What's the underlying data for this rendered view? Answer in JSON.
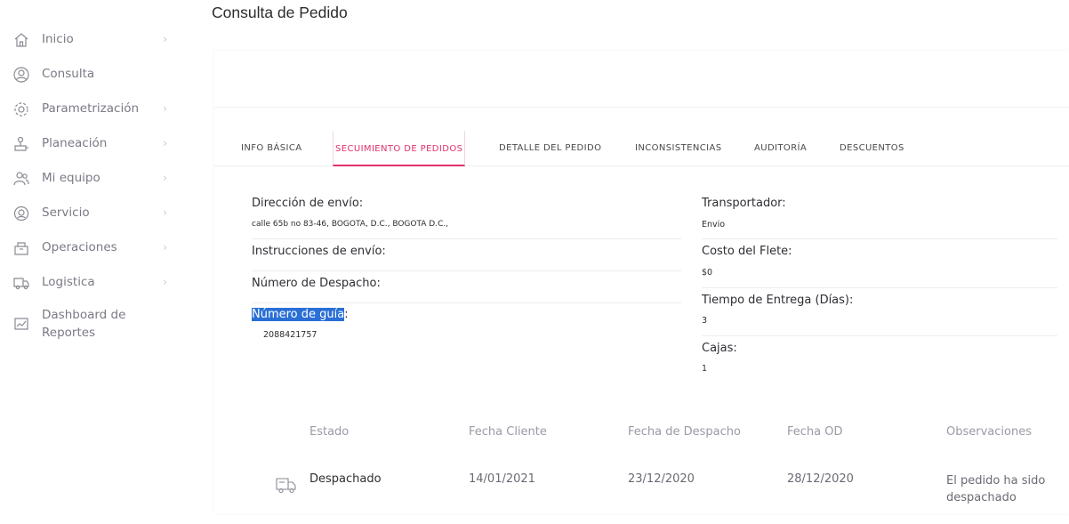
{
  "sidebar": {
    "items": [
      {
        "label": "Inicio",
        "icon": "home-icon",
        "chevron": "›"
      },
      {
        "label": "Consulta",
        "icon": "user-circle-icon",
        "chevron": ""
      },
      {
        "label": "Parametrización",
        "icon": "gear-icon",
        "chevron": "›"
      },
      {
        "label": "Planeación",
        "icon": "planning-icon",
        "chevron": "›"
      },
      {
        "label": "Mi equipo",
        "icon": "team-icon",
        "chevron": "›"
      },
      {
        "label": "Servicio",
        "icon": "support-icon",
        "chevron": "›"
      },
      {
        "label": "Operaciones",
        "icon": "operations-icon",
        "chevron": "›"
      },
      {
        "label": "Logistica",
        "icon": "truck-icon",
        "chevron": "›"
      },
      {
        "label_line1": "Dashboard de",
        "label_line2": "Reportes",
        "icon": "chart-icon",
        "chevron": ""
      }
    ]
  },
  "header": {
    "title": "Consulta de Pedido"
  },
  "tabs": [
    {
      "label": "INFO BÁSICA"
    },
    {
      "label": "SECUIMIENTO DE PEDIDOS",
      "active": true
    },
    {
      "label": "DETALLE DEL PEDIDO"
    },
    {
      "label": "INCONSISTENCIAS"
    },
    {
      "label": "AUDITORÍA"
    },
    {
      "label": "DESCUENTOS"
    }
  ],
  "shipping": {
    "left": {
      "direccion_label": "Dirección de envío:",
      "direccion_value": "calle 65b no 83-46, BOGOTA, D.C., BOGOTA D.C.,",
      "instrucciones_label": "Instrucciones de envío:",
      "despacho_label": "Número de Despacho:",
      "guia_label_selected": "Número de guía",
      "guia_label_rest": ":",
      "guia_value": "2088421757"
    },
    "right": {
      "transportador_label": "Transportador:",
      "transportador_value": "Envio",
      "flete_label": "Costo del Flete:",
      "flete_value": "$0",
      "tiempo_label": "Tiempo de Entrega (Días):",
      "tiempo_value": "3",
      "cajas_label": "Cajas:",
      "cajas_value": "1"
    }
  },
  "table": {
    "headers": [
      "Estado",
      "Fecha Cliente",
      "Fecha de Despacho",
      "Fecha OD",
      "Observaciones"
    ],
    "rows": [
      {
        "estado": "Despachado",
        "fecha_cliente": "14/01/2021",
        "fecha_despacho": "23/12/2020",
        "fecha_od": "28/12/2020",
        "observaciones_line1": "El pedido ha sido",
        "observaciones_line2": "despachado",
        "icon": "delivery-truck-icon"
      }
    ]
  },
  "colors": {
    "accent": "#e0306e",
    "selection": "#2a6fd6"
  }
}
